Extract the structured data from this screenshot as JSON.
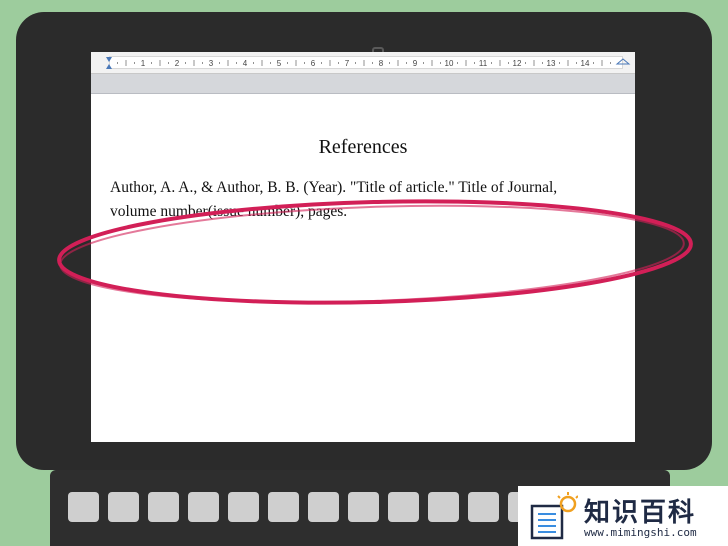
{
  "document": {
    "heading": "References",
    "citation_line_1": "Author, A. A., & Author, B. B. (Year). \"Title of article.\" Title of Journal,",
    "citation_line_2": "volume number(issue number), pages."
  },
  "ruler": {
    "numbers": [
      "1",
      "2",
      "3",
      "4",
      "5",
      "6",
      "7",
      "8",
      "9",
      "10",
      "11",
      "12",
      "13",
      "14"
    ]
  },
  "watermark": {
    "title": "知识百科",
    "url": "www.mimingshi.com"
  },
  "colors": {
    "background": "#9dcc9d",
    "device": "#2b2b2b",
    "highlight_ellipse": "#d21f57"
  }
}
